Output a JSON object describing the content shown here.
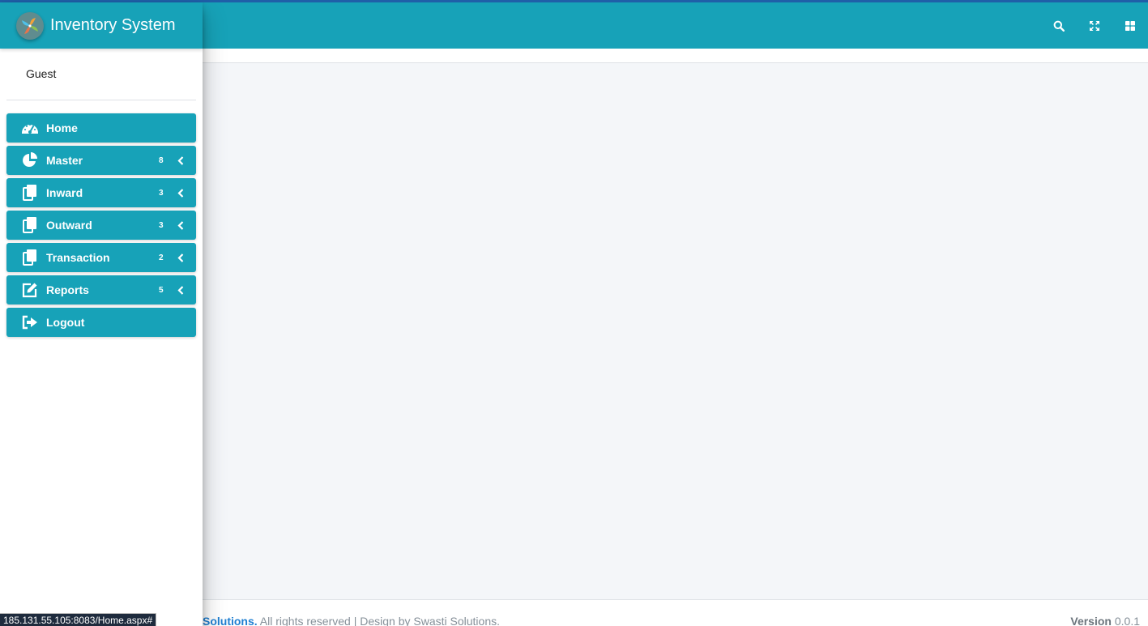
{
  "app": {
    "title": "Inventory System"
  },
  "user": {
    "name": "Guest"
  },
  "topbar": {
    "icons": [
      "search-icon",
      "expand-icon",
      "grid-icon"
    ]
  },
  "nav": {
    "items": [
      {
        "label": "Home",
        "badge": "",
        "icon": "dashboard-icon"
      },
      {
        "label": "Master",
        "badge": "8",
        "icon": "pie-chart-icon"
      },
      {
        "label": "Inward",
        "badge": "3",
        "icon": "copy-icon"
      },
      {
        "label": "Outward",
        "badge": "3",
        "icon": "copy-icon"
      },
      {
        "label": "Transaction",
        "badge": "2",
        "icon": "copy-icon"
      },
      {
        "label": "Reports",
        "badge": "5",
        "icon": "edit-icon"
      },
      {
        "label": "Logout",
        "badge": "",
        "icon": "sign-out-icon"
      }
    ]
  },
  "footer": {
    "brand": "Solutions.",
    "rights": " All rights reserved | Design by Swasti Solutions.",
    "version_label": "Version",
    "version_value": " 0.0.1"
  },
  "status_bar": {
    "url": "185.131.55.105:8083/Home.aspx#"
  },
  "colors": {
    "primary": "#17a2b8",
    "stripe": "#1f5fa8",
    "background": "#f4f6f9",
    "footer_brand": "#1f7fd1"
  }
}
